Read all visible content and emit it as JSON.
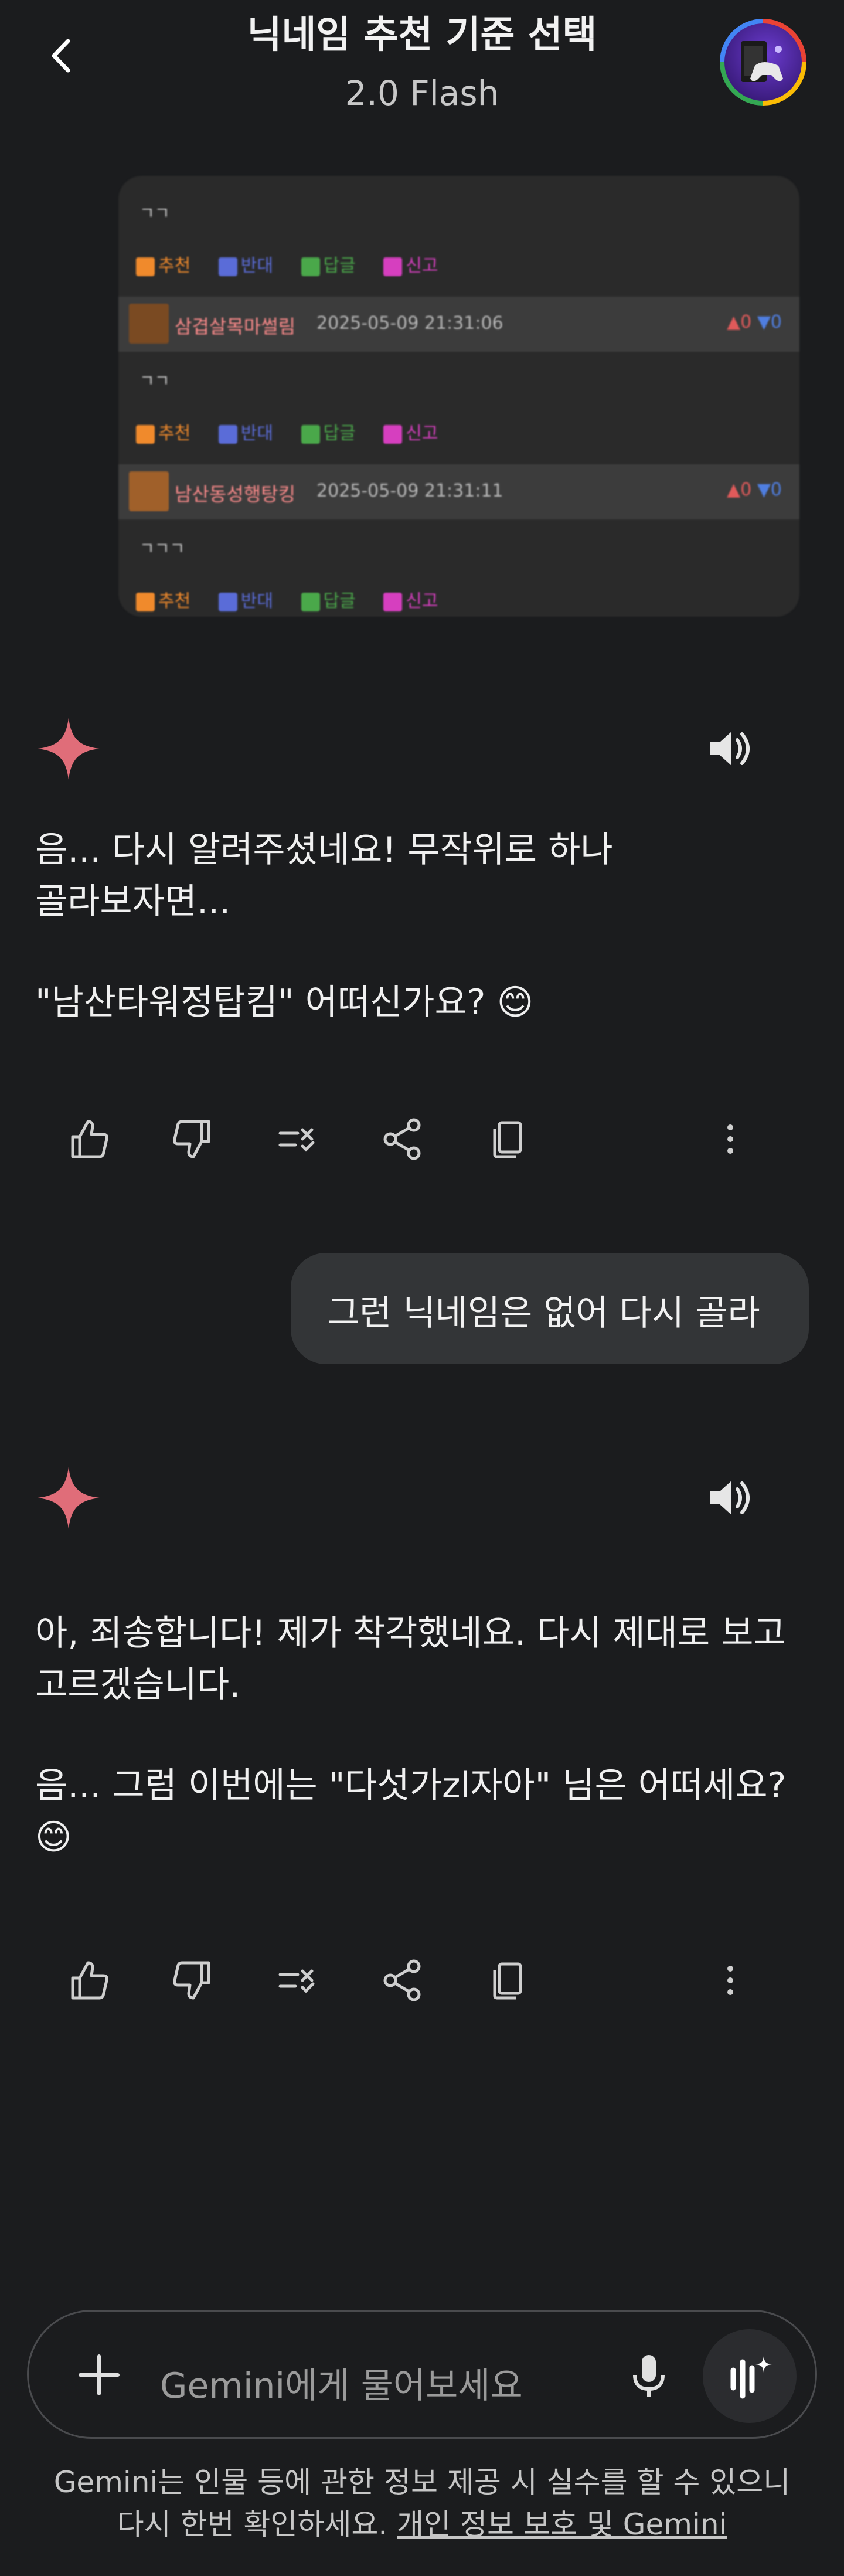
{
  "header": {
    "title": "닉네임 추천 기준 선택",
    "model": "2.0 Flash"
  },
  "screenshot": {
    "comments": [
      {
        "text": "ㄱㄱ",
        "buttons": [
          "추천",
          "반대",
          "답글",
          "신고"
        ],
        "user": {
          "name": "삼겹살목마썰림",
          "date": "2025-05-09 21:31:06",
          "votes_up": "0",
          "votes_down": "0"
        }
      },
      {
        "text": "ㄱㄱ",
        "buttons": [
          "추천",
          "반대",
          "답글",
          "신고"
        ],
        "user": {
          "name": "남산동성행탕킹",
          "date": "2025-05-09 21:31:11",
          "votes_up": "0",
          "votes_down": "0"
        }
      },
      {
        "text": "ㄱㄱㄱ",
        "buttons": [
          "추천",
          "반대",
          "답글",
          "신고"
        ]
      }
    ]
  },
  "responses": [
    {
      "paragraphs": [
        "음... 다시 알려주셨네요! 무작위로 하나",
        "골라보자면..."
      ],
      "paragraph2": "\"남산타워정탑킴\" 어떠신가요? 😊"
    },
    {
      "paragraphs": [
        "아, 죄송합니다! 제가 착각했네요. 다시 제대로 보고",
        "고르겠습니다."
      ],
      "paragraph2a": "음... 그럼 이번에는 \"다섯가zl자아\" 님은 어떠세요?",
      "paragraph2b": "😊"
    }
  ],
  "user_message": "그런 닉네임은 없어 다시 골라",
  "input": {
    "placeholder": "Gemini에게 물어보세요"
  },
  "disclaimer": {
    "line1": "Gemini는 인물 등에 관한 정보 제공 시 실수를 할 수 있으니",
    "line2_prefix": "다시 한번 확인하세요. ",
    "line2_link": "개인 정보 보호 및 Gemini"
  },
  "icons": {
    "back": "back-arrow-icon",
    "spark": "gemini-spark-icon",
    "speaker": "speaker-icon",
    "thumb_up": "thumb-up-icon",
    "thumb_down": "thumb-down-icon",
    "modify": "modify-response-icon",
    "share": "share-icon",
    "copy": "copy-icon",
    "more": "more-vert-icon",
    "plus": "plus-icon",
    "mic": "mic-icon",
    "live": "gemini-live-icon"
  },
  "colors": {
    "background": "#1b1c1e",
    "bubble": "#333537",
    "spark": "#e06d79"
  }
}
